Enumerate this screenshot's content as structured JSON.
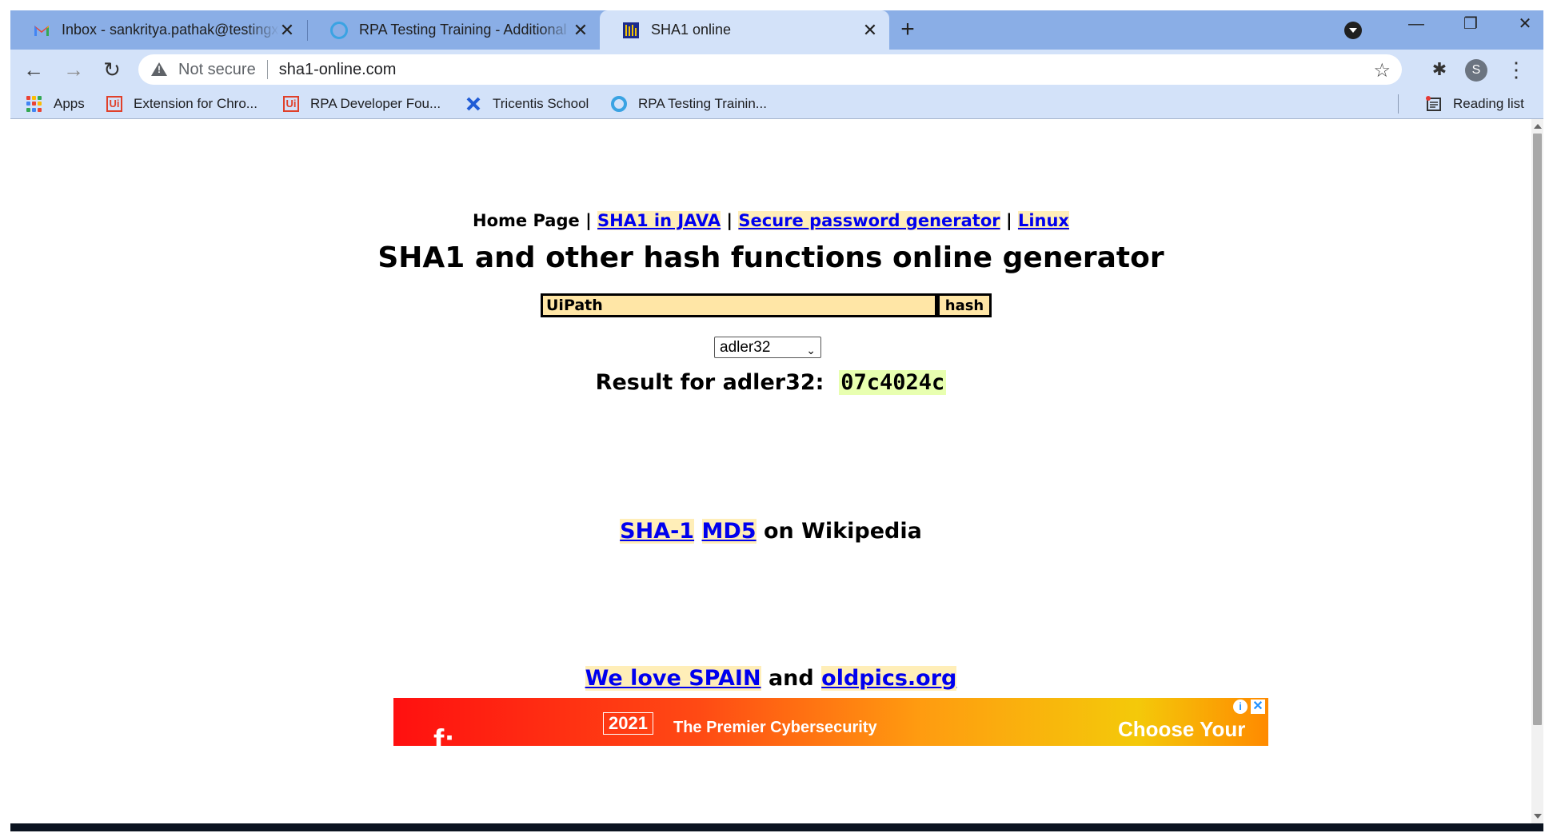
{
  "tabs": [
    {
      "title": "Inbox - sankritya.pathak@testingxperts.com",
      "icon": "gmail-icon",
      "active": false
    },
    {
      "title": "RPA Testing Training - Additional Resources",
      "icon": "ring-icon",
      "active": false
    },
    {
      "title": "SHA1 online",
      "icon": "sha1-site-icon",
      "active": true
    }
  ],
  "window_controls": {
    "new_tab": "+",
    "minimize": "—",
    "restore": "❐",
    "close": "✕"
  },
  "toolbar": {
    "back": "←",
    "forward": "→",
    "reload": "↻",
    "security_label": "Not secure",
    "url": "sha1-online.com",
    "bookmark_star": "☆",
    "extensions": "✱",
    "profile_initial": "S",
    "menu": "⋮"
  },
  "bookmarks": [
    {
      "label": "Apps",
      "icon": "apps-grid-icon"
    },
    {
      "label": "Extension for Chro...",
      "icon": "uipath-icon"
    },
    {
      "label": "RPA Developer Fou...",
      "icon": "uipath-icon"
    },
    {
      "label": "Tricentis School",
      "icon": "tricentis-icon"
    },
    {
      "label": "RPA Testing Trainin...",
      "icon": "ring-icon"
    }
  ],
  "reading_list": "Reading list",
  "page": {
    "nav": {
      "home": "Home Page",
      "sep": "|",
      "sha1_java": "SHA1 in JAVA",
      "password_gen": "Secure password generator",
      "linux": "Linux"
    },
    "heading": "SHA1 and other hash functions online generator",
    "input_value": "UiPath",
    "hash_button": "hash",
    "algorithm": "adler32",
    "result_label": "Result for adler32:",
    "result_value": "07c4024c",
    "wiki_sha1": "SHA-1",
    "wiki_md5": "MD5",
    "wiki_suffix": "on Wikipedia",
    "spain_link": "We love SPAIN",
    "and_text": "and",
    "oldpics_link": "oldpics.org",
    "ad": {
      "year": "2021",
      "text": "The Premier Cybersecurity",
      "cta": "Choose Your"
    }
  },
  "colors": {
    "tabstrip": "#8aaee6",
    "toolbar": "#d3e2f9",
    "link": "#0000ee",
    "link_bg": "#ffeeb8",
    "input_bg": "#ffe6a6",
    "result_bg": "#e8ffb0"
  }
}
